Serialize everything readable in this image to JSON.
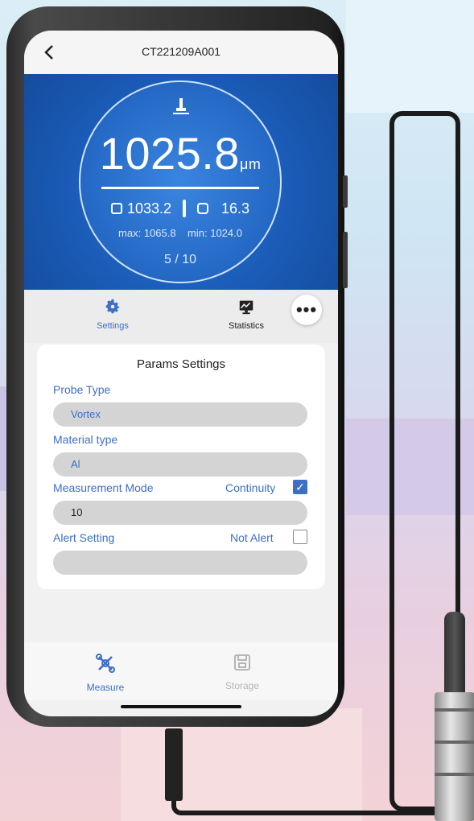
{
  "header": {
    "title": "CT221209A001"
  },
  "reading": {
    "value": "1025.8",
    "unit": "μm",
    "avg": "1033.2",
    "std": "16.3",
    "max_label": "max:",
    "max": "1065.8",
    "min_label": "min:",
    "min": "1024.0",
    "count": "5 / 10"
  },
  "tabs": [
    {
      "label": "Settings",
      "icon": "gear-icon",
      "color": "#3d6fc4"
    },
    {
      "label": "Statistics",
      "icon": "chart-icon",
      "color": "#222222"
    }
  ],
  "params": {
    "title": "Params Settings",
    "probe_type_label": "Probe Type",
    "probe_type_value": "Vortex",
    "material_label": "Material type",
    "material_value": "Al",
    "mode_label": "Measurement Mode",
    "continuity_label": "Continuity",
    "continuity_checked": true,
    "mode_value": "10",
    "alert_label": "Alert Setting",
    "not_alert_label": "Not Alert",
    "not_alert_checked": false,
    "alert_value": ""
  },
  "bottom_nav": [
    {
      "label": "Measure",
      "icon": "measure-icon",
      "active": true
    },
    {
      "label": "Storage",
      "icon": "storage-icon",
      "active": false
    }
  ],
  "colors": {
    "accent": "#3d6fc4",
    "hero": "#1a5cb8"
  }
}
